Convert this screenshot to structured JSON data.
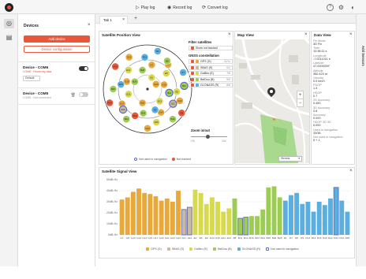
{
  "topbar": {
    "play_label": "Play log",
    "record_label": "Record log",
    "convert_label": "Convert log"
  },
  "devices_panel": {
    "title": "Devices",
    "add_label": "Add device",
    "config_label": "Device configuration",
    "devices": [
      {
        "name": "Device - COM6",
        "status": "COM6 · Receiving data",
        "select_value": "Default",
        "enabled": true
      },
      {
        "name": "Device - COM5",
        "status": "COM5 · Not connected",
        "enabled": false
      }
    ]
  },
  "tabs": [
    {
      "label": "Tab 1"
    }
  ],
  "satellite_view": {
    "title": "Satellite Position View",
    "filter_title": "Filter satellites",
    "show_not_used_label": "Show not tracked",
    "constellation_title": "GNSS constellation",
    "constellations": [
      {
        "name": "GPS (G)",
        "count": "11/11",
        "color": "#e8a93a"
      },
      {
        "name": "SBAS (S)",
        "count": "0/2",
        "color": "#c9b9a0"
      },
      {
        "name": "Galileo (E)",
        "count": "7/8",
        "color": "#d7d94e"
      },
      {
        "name": "BeiDou (B)",
        "count": "9/9",
        "color": "#9ccc52"
      },
      {
        "name": "GLONASS (R)",
        "count": "6/8",
        "color": "#5aaee0"
      }
    ],
    "zoom_label": "Zoom in/out",
    "zoom_min": "1%",
    "zoom_max": "10x",
    "legend_used": "Not used in navigation",
    "legend_not_tracked": "Not tracked"
  },
  "map_view": {
    "title": "Map View",
    "layer_select": "Streets",
    "zoom_in": "+",
    "zoom_out": "−",
    "marker_label": "",
    "park_label": "",
    "place_label": "Fi"
  },
  "data_view": {
    "title": "Data View",
    "items": [
      {
        "label": "Fix Mode",
        "value": "3D Fix"
      },
      {
        "label": "Time",
        "value": "10:38:11 s"
      },
      {
        "label": "Longitude",
        "value": "-7.0011011 s"
      },
      {
        "label": "Latitude",
        "value": "47.0000000°"
      },
      {
        "label": "Altitude",
        "value": "350.423 m"
      },
      {
        "label": "Velocity",
        "value": "0.0 km/h"
      },
      {
        "label": "PDOP",
        "value": "1.3"
      },
      {
        "label": "HDOP",
        "value": "0.7"
      },
      {
        "label": "2D Accuracy",
        "value": "0.450"
      },
      {
        "label": "3D Accuracy",
        "value": "0.8"
      },
      {
        "label": "Accuracy",
        "value": "0.000"
      },
      {
        "label": "HDOP 3D 3D",
        "value": "0.000"
      },
      {
        "label": "Used in navigation",
        "value": "33/38"
      },
      {
        "label": "Not used in navigation",
        "value": "5 + 1"
      }
    ]
  },
  "signal_view": {
    "title": "Satellite Signal View",
    "legend": [
      "GPS (G)",
      "SBAS (S)",
      "Galileo (E)",
      "BeiDou (B)",
      "GLONASS (R)",
      "Not used in navigation"
    ]
  },
  "chart_data": {
    "type": "bar",
    "title": "Satellite Signal View",
    "ylim": [
      0,
      50
    ],
    "y_ticks": [
      "0dB-Hz",
      "10dB-Hz",
      "20dB-Hz",
      "30dB-Hz",
      "40dB-Hz",
      "50dB-Hz"
    ],
    "categories": [
      "G7",
      "G8",
      "G10",
      "G13",
      "G14",
      "G15",
      "G17",
      "G19",
      "G21",
      "G23",
      "G24",
      "S21",
      "S24",
      "E1",
      "E5",
      "E9",
      "E13",
      "E15",
      "E21",
      "E31",
      "B8",
      "B11",
      "B14",
      "B16",
      "B23",
      "B24",
      "B25",
      "B26",
      "B28",
      "R1",
      "R7",
      "R8",
      "R9",
      "R13",
      "R14",
      "R15",
      "R16",
      "R22",
      "R23",
      "R24",
      "R25"
    ],
    "values": [
      32,
      34,
      39,
      42,
      38,
      37,
      35,
      31,
      33,
      30,
      40,
      23,
      25,
      41,
      38,
      28,
      34,
      30,
      21,
      24,
      33,
      15,
      16,
      17,
      17,
      23,
      43,
      44,
      34,
      31,
      36,
      38,
      28,
      30,
      21,
      30,
      27,
      33,
      43,
      31,
      21
    ],
    "groups": [
      "G",
      "G",
      "G",
      "G",
      "G",
      "G",
      "G",
      "G",
      "G",
      "G",
      "G",
      "S",
      "S",
      "E",
      "E",
      "E",
      "E",
      "E",
      "E",
      "E",
      "B",
      "B",
      "B",
      "B",
      "B",
      "B",
      "B",
      "B",
      "B",
      "R",
      "R",
      "R",
      "R",
      "R",
      "R",
      "R",
      "R",
      "R",
      "R",
      "R",
      "R"
    ],
    "not_used": [
      false,
      false,
      false,
      false,
      false,
      false,
      false,
      false,
      false,
      false,
      false,
      true,
      true,
      false,
      false,
      false,
      false,
      false,
      false,
      false,
      false,
      true,
      true,
      false,
      false,
      false,
      false,
      false,
      false,
      false,
      false,
      false,
      false,
      false,
      false,
      false,
      false,
      false,
      true,
      false,
      false
    ],
    "group_colors": {
      "G": "#e8a93a",
      "S": "#c9b9a0",
      "E": "#d7d94e",
      "B": "#9ccc52",
      "R": "#5aaee0"
    },
    "not_used_color": "#5a6bd8",
    "grid": true,
    "legend_placement": "bottom"
  },
  "sky_data": {
    "not_used_color": "#5a6bd8",
    "not_tracked_color": "#e8573a",
    "satellites": [
      {
        "id": "G7",
        "az": 10,
        "el": 40,
        "c": "G"
      },
      {
        "id": "G8",
        "az": 40,
        "el": 25,
        "c": "G"
      },
      {
        "id": "G10",
        "az": 75,
        "el": 55,
        "c": "G"
      },
      {
        "id": "G13",
        "az": 110,
        "el": 20,
        "c": "G"
      },
      {
        "id": "G14",
        "az": 150,
        "el": 35,
        "c": "G"
      },
      {
        "id": "G15",
        "az": 200,
        "el": 60,
        "c": "G"
      },
      {
        "id": "G17",
        "az": 240,
        "el": 30,
        "c": "G"
      },
      {
        "id": "G19",
        "az": 290,
        "el": 45,
        "c": "G"
      },
      {
        "id": "G21",
        "az": 330,
        "el": 15,
        "c": "G"
      },
      {
        "id": "G23",
        "az": 60,
        "el": 70,
        "c": "G"
      },
      {
        "id": "G24",
        "az": 180,
        "el": 10,
        "c": "G"
      },
      {
        "id": "S21",
        "az": 120,
        "el": 30,
        "c": "S",
        "nu": true
      },
      {
        "id": "S24",
        "az": 230,
        "el": 25,
        "c": "S",
        "nu": true
      },
      {
        "id": "E1",
        "az": 20,
        "el": 65,
        "c": "E"
      },
      {
        "id": "E5",
        "az": 50,
        "el": 40,
        "c": "E"
      },
      {
        "id": "E9",
        "az": 95,
        "el": 30,
        "c": "E"
      },
      {
        "id": "E13",
        "az": 135,
        "el": 55,
        "c": "E"
      },
      {
        "id": "E15",
        "az": 165,
        "el": 20,
        "c": "E"
      },
      {
        "id": "E21",
        "az": 255,
        "el": 50,
        "c": "E"
      },
      {
        "id": "E31",
        "az": 315,
        "el": 35,
        "c": "E"
      },
      {
        "id": "B8",
        "az": 35,
        "el": 20,
        "c": "B"
      },
      {
        "id": "B11",
        "az": 85,
        "el": 15,
        "c": "B",
        "nu": true
      },
      {
        "id": "B14",
        "az": 100,
        "el": 45,
        "c": "B",
        "nu": true
      },
      {
        "id": "B16",
        "az": 140,
        "el": 10,
        "c": "B"
      },
      {
        "id": "B23",
        "az": 190,
        "el": 40,
        "c": "B"
      },
      {
        "id": "B24",
        "az": 215,
        "el": 15,
        "c": "B"
      },
      {
        "id": "B25",
        "az": 270,
        "el": 20,
        "c": "B"
      },
      {
        "id": "B26",
        "az": 300,
        "el": 60,
        "c": "B"
      },
      {
        "id": "B28",
        "az": 345,
        "el": 50,
        "c": "B"
      },
      {
        "id": "R1",
        "az": 15,
        "el": 10,
        "c": "R"
      },
      {
        "id": "R7",
        "az": 65,
        "el": 10,
        "c": "R"
      },
      {
        "id": "R8",
        "az": 125,
        "el": 5,
        "c": "R",
        "nt": true
      },
      {
        "id": "R9",
        "az": 160,
        "el": 45,
        "c": "R"
      },
      {
        "id": "R13",
        "az": 205,
        "el": 30,
        "c": "R",
        "nt": true
      },
      {
        "id": "R14",
        "az": 250,
        "el": 8,
        "c": "R",
        "nt": true
      },
      {
        "id": "R15",
        "az": 280,
        "el": 35,
        "c": "R"
      },
      {
        "id": "R16",
        "az": 305,
        "el": 10,
        "c": "R",
        "nt": true
      },
      {
        "id": "R22",
        "az": 355,
        "el": 25,
        "c": "R"
      }
    ]
  }
}
